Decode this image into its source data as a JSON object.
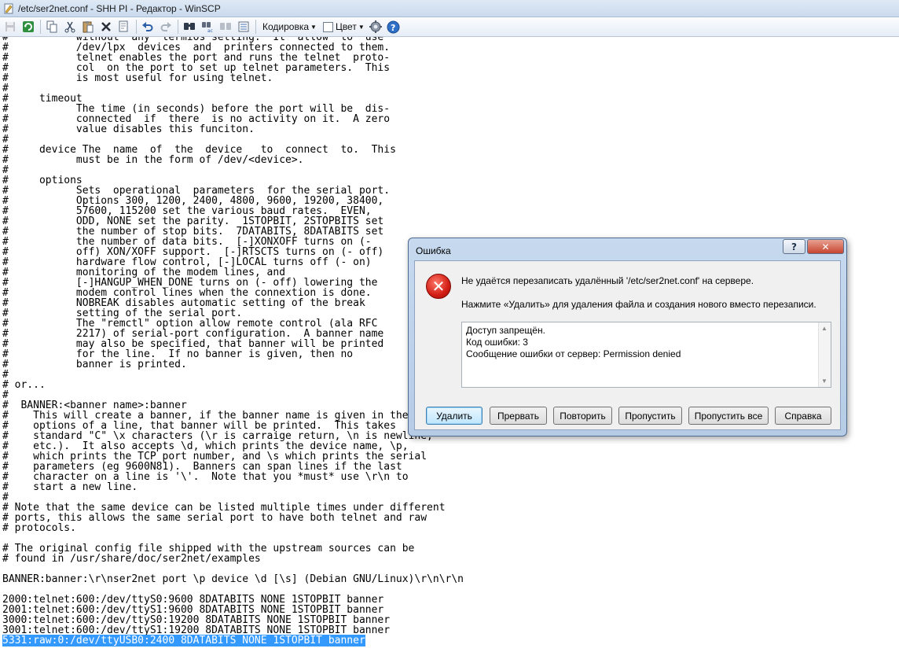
{
  "window": {
    "title": "/etc/ser2net.conf - SHH PI - Редактор - WinSCP"
  },
  "toolbar": {
    "encoding_label": "Кодировка",
    "color_label": "Цвет",
    "icons": [
      "save-icon",
      "refresh-icon",
      "copy-icon",
      "cut-icon",
      "paste-icon",
      "delete-icon",
      "undo-icon",
      "redo-icon",
      "find-icon",
      "replace-icon",
      "find-next-icon",
      "goto-line-icon",
      "settings-icon",
      "help-icon"
    ]
  },
  "editor": {
    "lines": [
      "#           without  any  termios setting.  It  allow  to  use",
      "#           /dev/lpx  devices  and  printers connected to them.",
      "#           telnet enables the port and runs the telnet  proto-",
      "#           col  on the port to set up telnet parameters.  This",
      "#           is most useful for using telnet.",
      "#",
      "#     timeout",
      "#           The time (in seconds) before the port will be  dis-",
      "#           connected  if  there  is no activity on it.  A zero",
      "#           value disables this funciton.",
      "#",
      "#     device The  name  of  the  device   to  connect  to.  This",
      "#           must be in the form of /dev/<device>.",
      "#",
      "#     options",
      "#           Sets  operational  parameters  for the serial port.",
      "#           Options 300, 1200, 2400, 4800, 9600, 19200, 38400,",
      "#           57600, 115200 set the various baud rates.  EVEN,",
      "#           ODD, NONE set the parity.  1STOPBIT, 2STOPBITS set",
      "#           the number of stop bits.  7DATABITS, 8DATABITS set",
      "#           the number of data bits.  [-]XONXOFF turns on (-",
      "#           off) XON/XOFF support.  [-]RTSCTS turns on (- off)",
      "#           hardware flow control, [-]LOCAL turns off (- on)",
      "#           monitoring of the modem lines, and",
      "#           [-]HANGUP_WHEN_DONE turns on (- off) lowering the",
      "#           modem control lines when the connextion is done.",
      "#           NOBREAK disables automatic setting of the break",
      "#           setting of the serial port.",
      "#           The \"remctl\" option allow remote control (ala RFC",
      "#           2217) of serial-port configuration.  A banner name",
      "#           may also be specified, that banner will be printed",
      "#           for the line.  If no banner is given, then no",
      "#           banner is printed.",
      "#",
      "# or...",
      "#",
      "#  BANNER:<banner name>:banner",
      "#    This will create a banner, if the banner name is given in the",
      "#    options of a line, that banner will be printed.  This takes",
      "#    standard \"C\" \\x characters (\\r is carraige return, \\n is newline,",
      "#    etc.).  It also accepts \\d, which prints the device name, \\p,",
      "#    which prints the TCP port number, and \\s which prints the serial",
      "#    parameters (eg 9600N81).  Banners can span lines if the last",
      "#    character on a line is '\\'.  Note that you *must* use \\r\\n to",
      "#    start a new line.",
      "#",
      "# Note that the same device can be listed multiple times under different",
      "# ports, this allows the same serial port to have both telnet and raw",
      "# protocols.",
      "",
      "# The original config file shipped with the upstream sources can be",
      "# found in /usr/share/doc/ser2net/examples",
      "",
      "BANNER:banner:\\r\\nser2net port \\p device \\d [\\s] (Debian GNU/Linux)\\r\\n\\r\\n",
      "",
      "2000:telnet:600:/dev/ttyS0:9600 8DATABITS NONE 1STOPBIT banner",
      "2001:telnet:600:/dev/ttyS1:9600 8DATABITS NONE 1STOPBIT banner",
      "3000:telnet:600:/dev/ttyS0:19200 8DATABITS NONE 1STOPBIT banner",
      "3001:telnet:600:/dev/ttyS1:19200 8DATABITS NONE 1STOPBIT banner",
      "5331:raw:0:/dev/ttyUSB0:2400 8DATABITS NONE 1STOPBIT banner"
    ],
    "selected_line_index": 59
  },
  "dialog": {
    "title": "Ошибка",
    "help_glyph": "?",
    "close_glyph": "✕",
    "icon": "error-icon",
    "message": "Не удаётся перезаписать удалённый '/etc/ser2net.conf' на сервере.",
    "hint": "Нажмите «Удалить» для удаления файла и создания нового вместо перезаписи.",
    "details": [
      "Доступ запрещён.",
      "Код ошибки: 3",
      "Сообщение ошибки от сервер: Permission denied"
    ],
    "buttons": {
      "delete": "Удалить",
      "abort": "Прервать",
      "retry": "Повторить",
      "skip": "Пропустить",
      "skip_all": "Пропустить все",
      "help": "Справка"
    }
  }
}
